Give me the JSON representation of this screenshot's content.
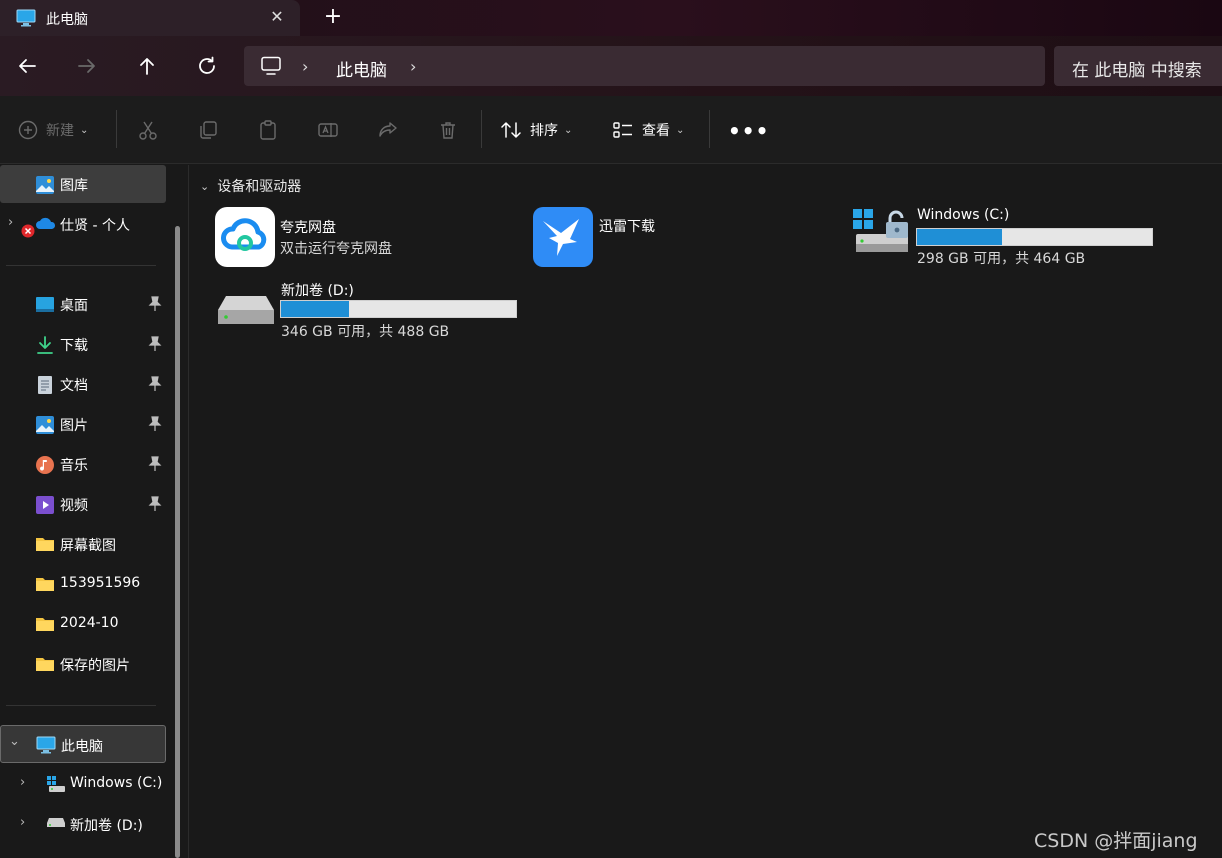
{
  "window": {
    "tab_title": "此电脑",
    "tab_close": "✕",
    "new_tab": "+"
  },
  "address": {
    "chevron": "›",
    "crumb": "此电脑",
    "search_placeholder": "在 此电脑 中搜索"
  },
  "toolbar": {
    "new_label": "新建",
    "sort_label": "排序",
    "view_label": "查看",
    "more_label": "•••",
    "caret": "⌄"
  },
  "sidebar": {
    "gallery": "图库",
    "onedrive": "仕贤 - 个人",
    "quick": [
      {
        "label": "桌面",
        "icon": "desktop-icon"
      },
      {
        "label": "下载",
        "icon": "download-icon"
      },
      {
        "label": "文档",
        "icon": "document-icon"
      },
      {
        "label": "图片",
        "icon": "pictures-icon"
      },
      {
        "label": "音乐",
        "icon": "music-icon"
      },
      {
        "label": "视频",
        "icon": "video-icon"
      }
    ],
    "folders": [
      "屏幕截图",
      "153951596",
      "2024-10",
      "保存的图片"
    ],
    "this_pc": "此电脑",
    "drive_c": "Windows (C:)",
    "drive_d": "新加卷 (D:)",
    "expand_glyph": "›",
    "collapse_glyph": "⌄"
  },
  "content": {
    "section_title": "设备和驱动器",
    "section_chevron": "⌄",
    "quark_name": "夸克网盘",
    "quark_sub": "双击运行夸克网盘",
    "xunlei_name": "迅雷下载",
    "drive_c": {
      "name": "Windows (C:)",
      "free_text": "298 GB 可用，共 464 GB",
      "used_fraction": 0.36
    },
    "drive_d": {
      "name": "新加卷 (D:)",
      "free_text": "346 GB 可用，共 488 GB",
      "used_fraction": 0.29
    }
  },
  "watermark": "CSDN @拌面jiang",
  "colors": {
    "accent": "#1f8fd6",
    "background": "#191919",
    "titlebar": "#2a0f1c"
  }
}
